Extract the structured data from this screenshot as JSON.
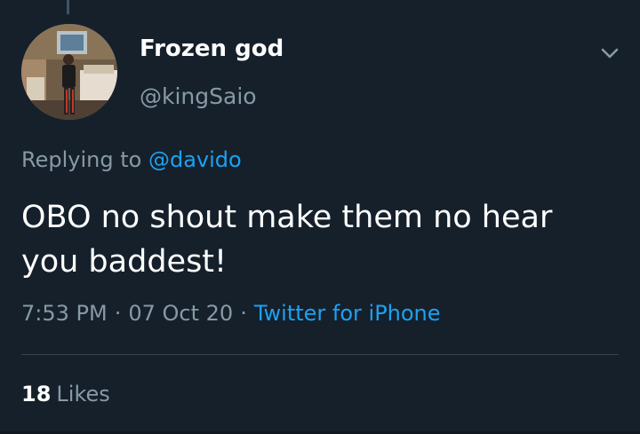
{
  "tweet": {
    "author": {
      "display_name": "Frozen god",
      "handle": "@kingSaio"
    },
    "reply_prefix": "Replying to",
    "reply_to": "@davido",
    "text": "OBO no shout make them no hear you baddest!",
    "time": "7:53 PM",
    "date": "07 Oct 20",
    "separator": "·",
    "source": "Twitter for iPhone",
    "likes_count": "18",
    "likes_label": "Likes"
  },
  "icons": {
    "menu": "chevron-down-icon",
    "avatar": "avatar"
  },
  "colors": {
    "background": "#15202b",
    "accent": "#1da1f2",
    "secondary_text": "#8899a6",
    "divider": "#38444d"
  }
}
